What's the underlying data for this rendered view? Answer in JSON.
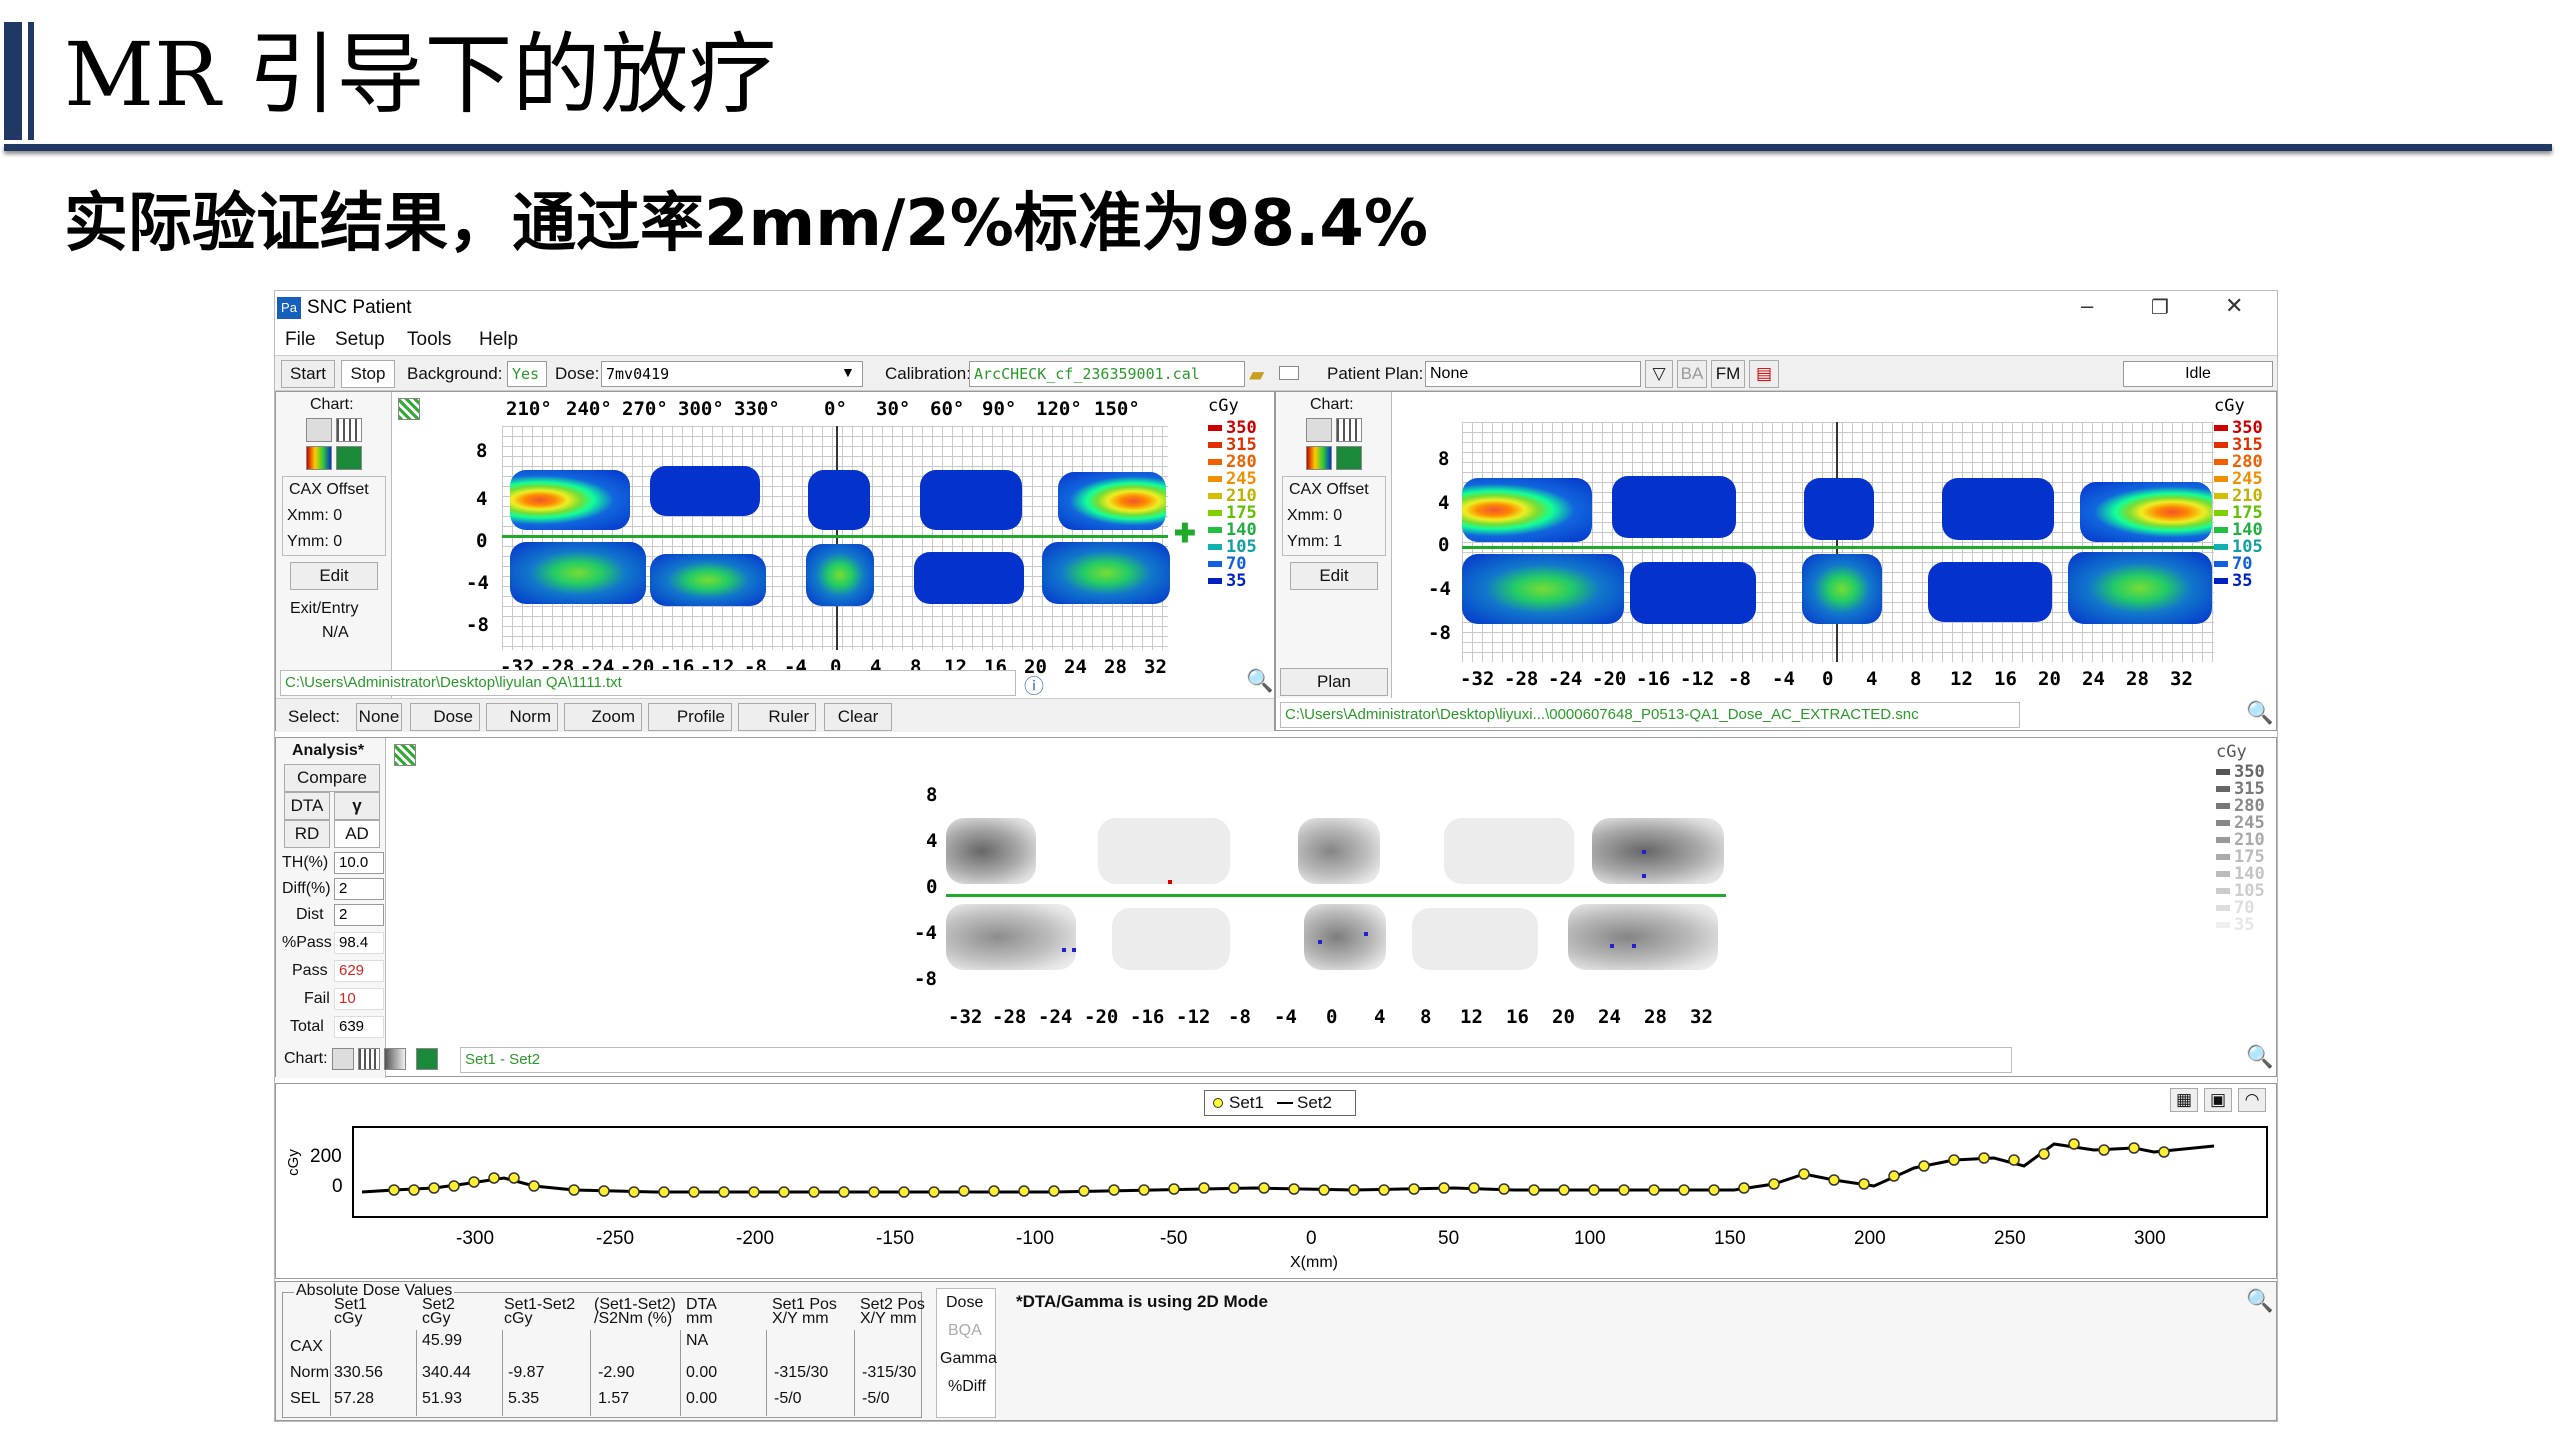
{
  "slide": {
    "title": "MR 引导下的放疗",
    "subtitle": "实际验证结果，通过率2mm/2%标准为98.4%"
  },
  "window": {
    "icon": "Pa",
    "title": "SNC Patient",
    "min": "–",
    "max": "❐",
    "close": "✕"
  },
  "menu": [
    "File",
    "Setup",
    "Tools",
    "Help"
  ],
  "toolbar": {
    "start": "Start",
    "stop": "Stop",
    "background_label": "Background:",
    "background_value": "Yes",
    "dose_label": "Dose:",
    "dose_value": "7mv0419",
    "calibration_label": "Calibration:",
    "calibration_value": "ArcCHECK_cf_236359001.cal",
    "patient_plan_label": "Patient Plan:",
    "patient_plan_value": "None",
    "ba": "BA",
    "fm": "FM",
    "status": "Idle"
  },
  "left_panel": {
    "chart": "Chart:",
    "cax_offset": "CAX Offset",
    "xmm": "Xmm: 0",
    "ymm": "Ymm: 0",
    "edit": "Edit",
    "exit_entry": "Exit/Entry",
    "na": "N/A",
    "path": "C:\\Users\\Administrator\\Desktop\\liyulan QA\\1111.txt",
    "top_angles": [
      "210°",
      "240°",
      "270°",
      "300°",
      "330°",
      "0°",
      "30°",
      "60°",
      "90°",
      "120°",
      "150°"
    ]
  },
  "right_panel": {
    "chart": "Chart:",
    "cax_offset": "CAX Offset",
    "xmm": "Xmm: 0",
    "ymm": "Ymm: 1",
    "edit": "Edit",
    "plan": "Plan",
    "path": "C:\\Users\\Administrator\\Desktop\\liyuxi...\\0000607648_P0513-QA1_Dose_AC_EXTRACTED.snc"
  },
  "select_bar": {
    "label": "Select:",
    "none": "None",
    "dose": "Dose",
    "norm": "Norm",
    "zoom": "Zoom",
    "profile": "Profile",
    "ruler": "Ruler",
    "clear": "Clear"
  },
  "x_ticks": [
    "-32",
    "-28",
    "-24",
    "-20",
    "-16",
    "-12",
    "-8",
    "-4",
    "0",
    "4",
    "8",
    "12",
    "16",
    "20",
    "24",
    "28",
    "32"
  ],
  "y_ticks": [
    "8",
    "4",
    "0",
    "-4",
    "-8"
  ],
  "legend": {
    "unit": "cGy",
    "levels": [
      "350",
      "315",
      "280",
      "245",
      "210",
      "175",
      "140",
      "105",
      "70",
      "35"
    ],
    "colors": [
      "#cc0000",
      "#e03000",
      "#f06000",
      "#f09000",
      "#d0c000",
      "#80d000",
      "#20c040",
      "#10b0b0",
      "#1060e0",
      "#0020c0"
    ]
  },
  "analysis": {
    "title": "Analysis*",
    "compare": "Compare",
    "dta": "DTA",
    "gamma": "γ",
    "rd": "RD",
    "ad": "AD",
    "th_label": "TH(%)",
    "th": "10.0",
    "diff_label": "Diff(%)",
    "diff": "2",
    "dist_label": "Dist",
    "dist": "2",
    "pass_pct_label": "%Pass",
    "pass_pct": "98.4",
    "pass_label": "Pass",
    "pass": "629",
    "fail_label": "Fail",
    "fail": "10",
    "total_label": "Total",
    "total": "639",
    "chart_label": "Chart:",
    "set_label": "Set1 - Set2"
  },
  "profile": {
    "legend_set1": "Set1",
    "legend_set2": "Set2",
    "ylabel": "cGy",
    "xlabel": "X(mm)",
    "y_ticks": [
      "200",
      "0"
    ],
    "x_ticks": [
      "-300",
      "-250",
      "-200",
      "-150",
      "-100",
      "-50",
      "0",
      "50",
      "100",
      "150",
      "200",
      "250",
      "300"
    ]
  },
  "dose_table": {
    "title": "Absolute Dose Values",
    "h_set1": "Set1",
    "h_set1_u": "cGy",
    "h_set2": "Set2",
    "h_set2_u": "cGy",
    "h_diff": "Set1-Set2",
    "h_diff_u": "cGy",
    "h_pct": "(Set1-Set2)",
    "h_pct_u": "/S2Nm (%)",
    "h_dta": "DTA",
    "h_dta_u": "mm",
    "h_pos1": "Set1 Pos",
    "h_pos1_u": "X/Y mm",
    "h_pos2": "Set2 Pos",
    "h_pos2_u": "X/Y mm",
    "rows": [
      {
        "label": "CAX",
        "set1": "",
        "set2": "45.99",
        "diff": "",
        "pct": "",
        "dta": "NA",
        "pos1": "",
        "pos2": ""
      },
      {
        "label": "Norm",
        "set1": "330.56",
        "set2": "340.44",
        "diff": "-9.87",
        "pct": "-2.90",
        "dta": "0.00",
        "pos1": "-315/30",
        "pos2": "-315/30"
      },
      {
        "label": "SEL",
        "set1": "57.28",
        "set2": "51.93",
        "diff": "5.35",
        "pct": "1.57",
        "dta": "0.00",
        "pos1": "-5/0",
        "pos2": "-5/0"
      }
    ],
    "dose": "Dose",
    "bqa": "BQA",
    "gamma": "Gamma",
    "pdiff": "%Diff",
    "note": "*DTA/Gamma is using 2D Mode"
  }
}
